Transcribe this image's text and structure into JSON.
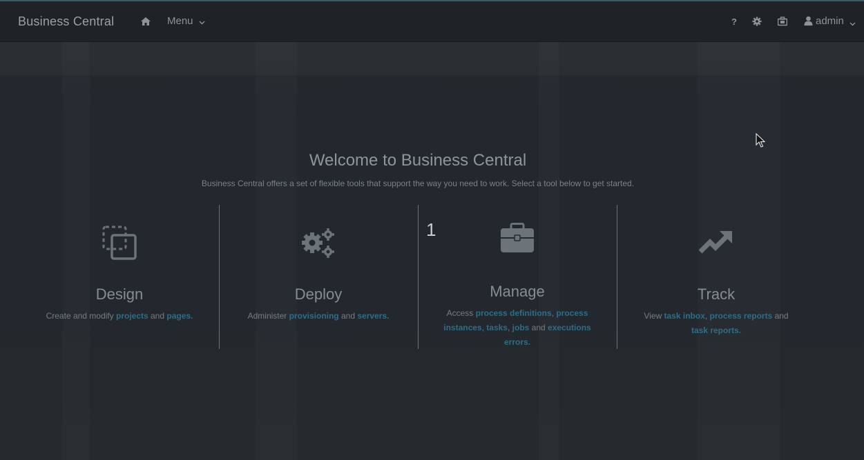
{
  "navbar": {
    "brand": "Business Central",
    "menu_label": "Menu",
    "user_label": "admin"
  },
  "welcome": {
    "title": "Welcome to Business Central",
    "subtitle": "Business Central offers a set of flexible tools that support the way you need to work. Select a tool below to get started."
  },
  "tiles": {
    "design": {
      "title": "Design",
      "icon": "design-copy-icon",
      "pre": "Create and modify ",
      "link1": "projects",
      "mid1": " and ",
      "link2": "pages."
    },
    "deploy": {
      "title": "Deploy",
      "icon": "cogs-icon",
      "pre": "Administer ",
      "link1": "provisioning",
      "mid1": " and ",
      "link2": "servers."
    },
    "manage": {
      "badge": "1",
      "title": "Manage",
      "icon": "briefcase-icon",
      "pre": "Access ",
      "link1": "process definitions",
      "sep1": ", ",
      "link2": "process instances",
      "sep2": ", ",
      "link3": "tasks",
      "sep3": ", ",
      "link4": "jobs",
      "mid": " and ",
      "link5": "executions errors."
    },
    "track": {
      "title": "Track",
      "icon": "trend-arrow-icon",
      "pre": "View ",
      "link1": "task inbox",
      "sep1": ", ",
      "link2": "process reports",
      "mid": " and ",
      "link3": "task reports."
    }
  },
  "colors": {
    "link": "#2d6e86",
    "navbar_bg": "#1f2326",
    "page_bg": "#21262b"
  }
}
